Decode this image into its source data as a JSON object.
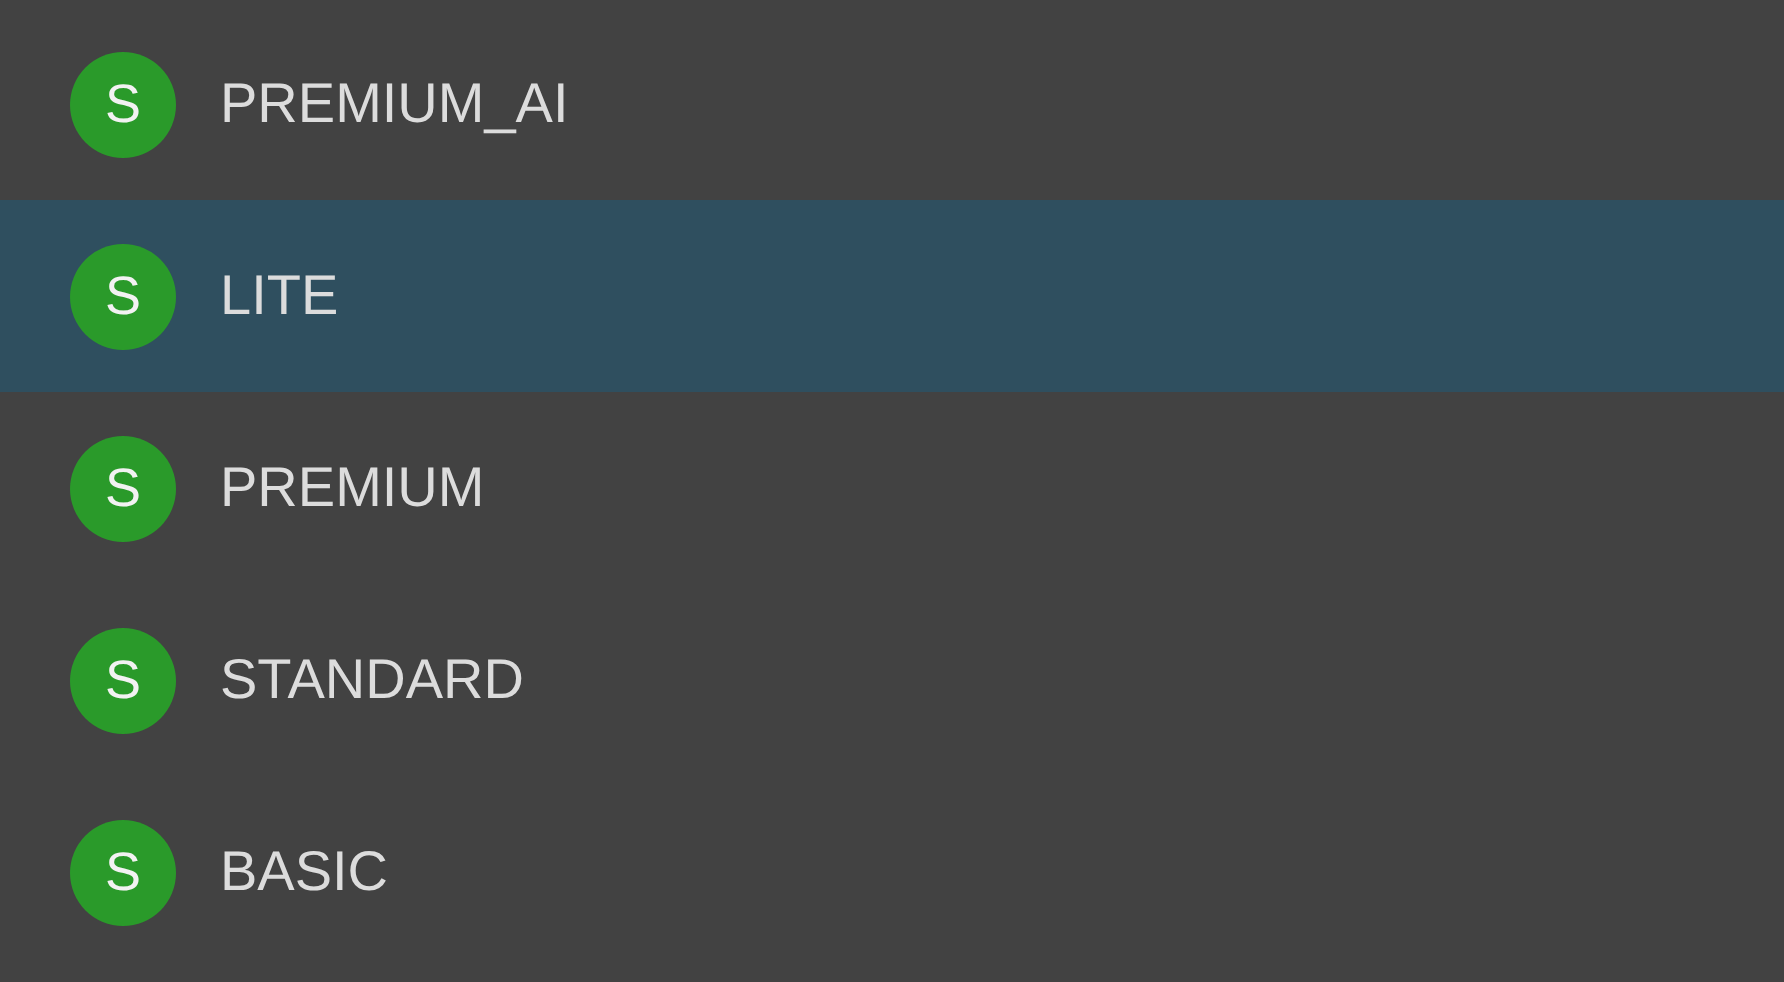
{
  "items": [
    {
      "letter": "S",
      "label": "PREMIUM_AI",
      "selected": false
    },
    {
      "letter": "S",
      "label": "LITE",
      "selected": true
    },
    {
      "letter": "S",
      "label": "PREMIUM",
      "selected": false
    },
    {
      "letter": "S",
      "label": "STANDARD",
      "selected": false
    },
    {
      "letter": "S",
      "label": "BASIC",
      "selected": false
    }
  ]
}
